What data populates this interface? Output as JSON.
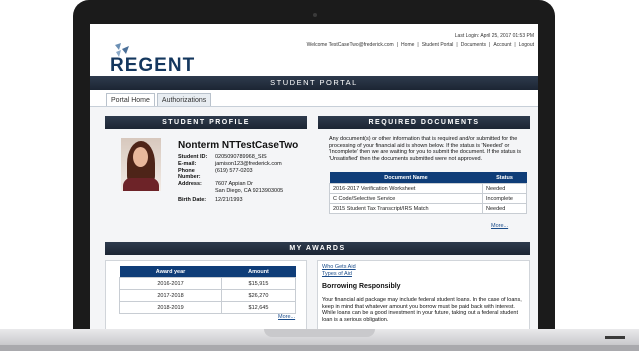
{
  "header": {
    "logo_text": "REGENT",
    "last_login": "Last Login: April 25, 2017 01:53 PM",
    "nav": [
      "Welcome TestCaseTwo@frederick.com",
      "|",
      "Home",
      "|",
      "Student Portal",
      "|",
      "Documents",
      "|",
      "Account",
      "|",
      "Logout"
    ]
  },
  "banner": "STUDENT PORTAL",
  "tabs": [
    {
      "label": "Portal Home"
    },
    {
      "label": "Authorizations"
    }
  ],
  "profile": {
    "section_title": "STUDENT PROFILE",
    "name": "Nonterm NTTestCaseTwo",
    "fields": [
      {
        "label": "Student ID:",
        "value": "0205090789968_SIS"
      },
      {
        "label": "E-mail:",
        "value": "jamison123@frederick.com"
      },
      {
        "label": "Phone Number:",
        "value": "(619) 577-0203"
      },
      {
        "label": "Address:",
        "value": "7607 Appian Dr"
      },
      {
        "label": "",
        "value": "San Diego, CA 9213903005"
      },
      {
        "label": "Birth Date:",
        "value": "12/21/1993"
      }
    ]
  },
  "required_documents": {
    "section_title": "REQUIRED DOCUMENTS",
    "intro": "Any document(s) or other information that is required and/or submitted for the processing of your financial aid is shown below. If the status is 'Needed' or 'Incomplete' then we are waiting for you to submit the document. If the status is 'Unsatisfied' then the documents submitted were not approved.",
    "columns": [
      "Document Name",
      "Status"
    ],
    "rows": [
      {
        "name": "2016-2017 Verification Worksheet",
        "status": "Needed"
      },
      {
        "name": "C Code/Selective Service",
        "status": "Incomplete"
      },
      {
        "name": "2015 Student Tax Transcript/IRS Match",
        "status": "Needed"
      }
    ],
    "more": "More..."
  },
  "awards": {
    "section_title": "MY AWARDS",
    "columns": [
      "Award year",
      "Amount"
    ],
    "rows": [
      {
        "year": "2016-2017",
        "amount": "$15,915"
      },
      {
        "year": "2017-2018",
        "amount": "$26,270"
      },
      {
        "year": "2018-2019",
        "amount": "$12,645"
      }
    ],
    "more": "More...",
    "links": [
      "Who Gets Aid",
      "Types of Aid"
    ],
    "heading": "Borrowing Responsibly",
    "body": "Your financial aid package may include federal student loans. In the case of loans, keep in mind that whatever amount you borrow must be paid back with interest. While loans can be a good investment in your future, taking out a federal student loan is a serious obligation."
  }
}
